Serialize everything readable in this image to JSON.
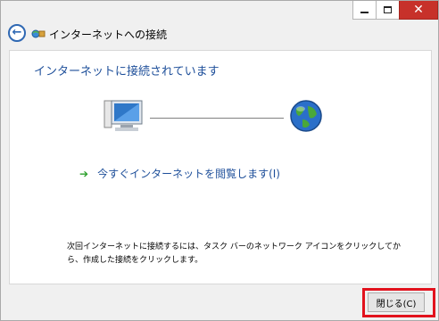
{
  "window": {
    "title": "インターネットへの接続",
    "caption_buttons": [
      "minimize-icon",
      "maximize-icon",
      "close-icon"
    ]
  },
  "content": {
    "heading": "インターネットに接続されています",
    "browse_link": "今すぐインターネットを閲覧します(I)",
    "note": "次回インターネットに接続するには、タスク バーのネットワーク アイコンをクリックしてから、作成した接続をクリックします。"
  },
  "footer": {
    "close_label": "閉じる(C)"
  },
  "colors": {
    "accent": "#1e4f9a",
    "highlight": "#e2121d",
    "close_caption": "#c7312a"
  }
}
